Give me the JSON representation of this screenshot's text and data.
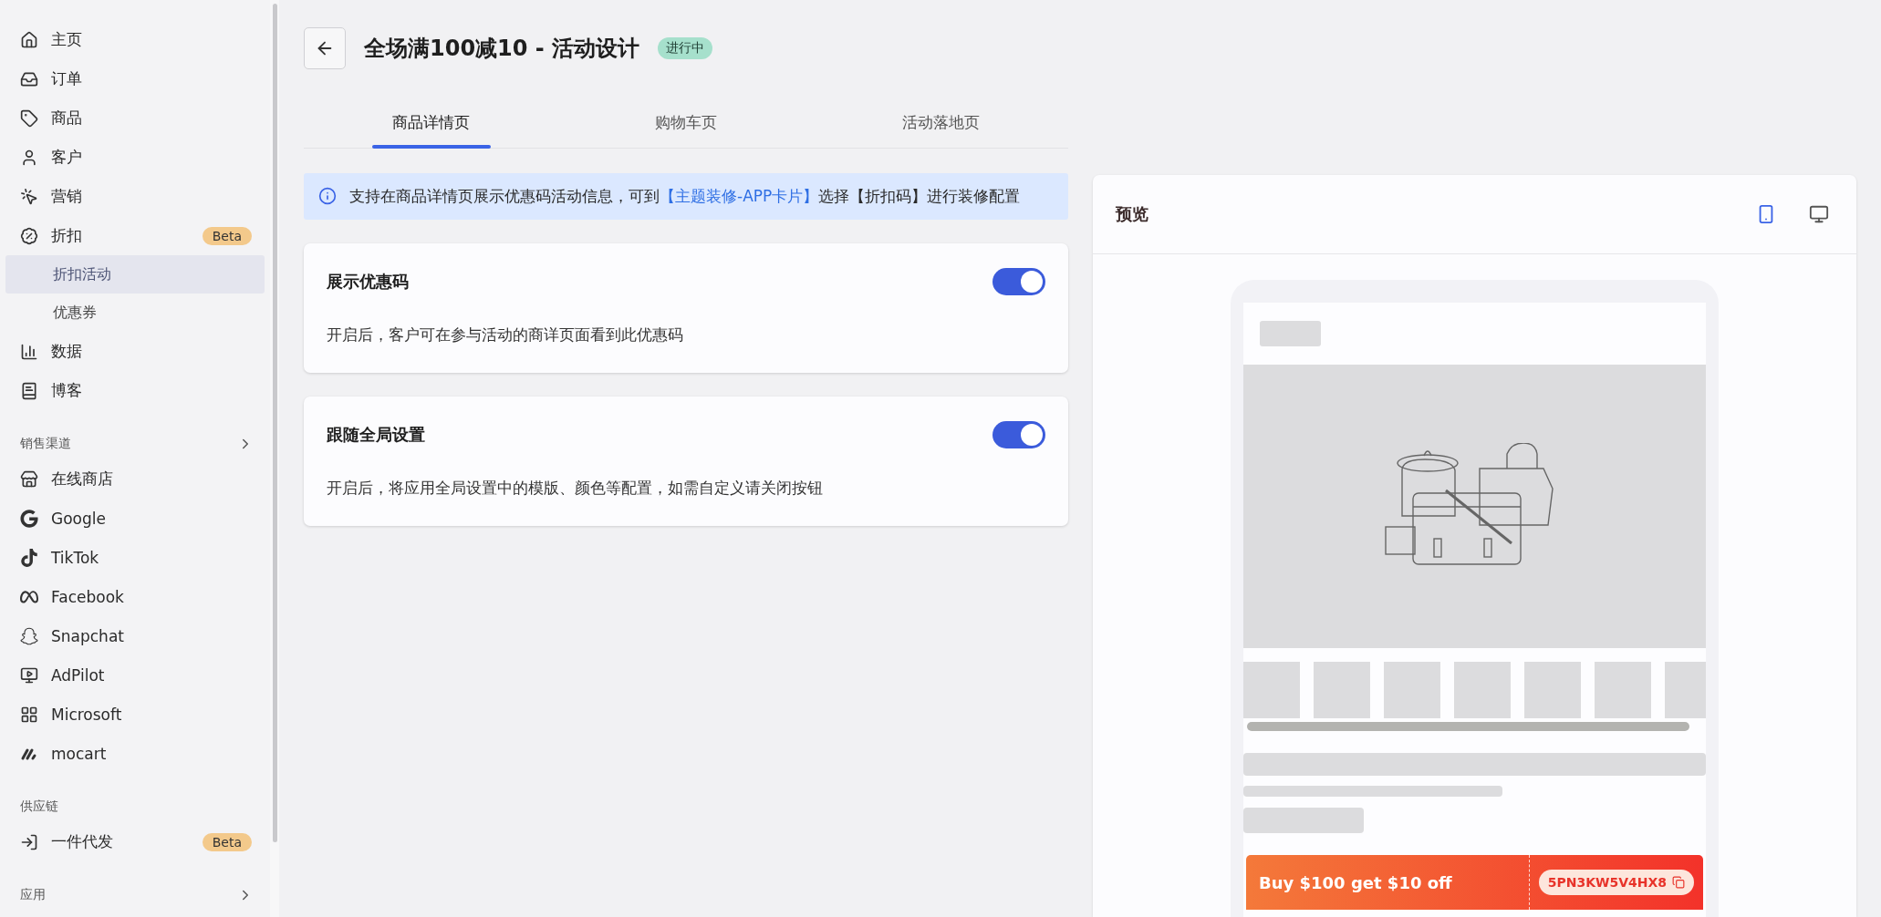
{
  "sidebar": {
    "sections": [
      {
        "items": [
          {
            "label": "主页",
            "selected": false
          },
          {
            "label": "订单",
            "selected": false
          },
          {
            "label": "商品",
            "selected": false
          },
          {
            "label": "客户",
            "selected": false
          },
          {
            "label": "营销",
            "selected": false
          },
          {
            "label": "折扣",
            "selected": false,
            "badge": "Beta",
            "children": [
              {
                "label": "折扣活动",
                "selected": true
              },
              {
                "label": "优惠券",
                "selected": false
              }
            ]
          },
          {
            "label": "数据",
            "selected": false
          },
          {
            "label": "博客",
            "selected": false
          }
        ]
      },
      {
        "title": "销售渠道",
        "collapsible": true,
        "items": [
          {
            "label": "在线商店",
            "selected": false
          },
          {
            "label": "Google",
            "selected": false
          },
          {
            "label": "TikTok",
            "selected": false
          },
          {
            "label": "Facebook",
            "selected": false
          },
          {
            "label": "Snapchat",
            "selected": false
          },
          {
            "label": "AdPilot",
            "selected": false
          },
          {
            "label": "Microsoft",
            "selected": false
          },
          {
            "label": "mocart",
            "selected": false
          }
        ]
      },
      {
        "title": "供应链",
        "collapsible": false,
        "items": [
          {
            "label": "一件代发",
            "selected": false,
            "badge": "Beta"
          }
        ]
      },
      {
        "title": "应用",
        "collapsible": true
      }
    ]
  },
  "header": {
    "title": "全场满100减10 - 活动设计",
    "status": "进行中"
  },
  "tabs": [
    {
      "label": "商品详情页",
      "selected": true
    },
    {
      "label": "购物车页",
      "selected": false
    },
    {
      "label": "活动落地页",
      "selected": false
    }
  ],
  "info": {
    "text_before": "支持在商品详情页展示优惠码活动信息，可到",
    "link": "【主题装修-APP卡片】",
    "text_after": "选择【折扣码】进行装修配置"
  },
  "cards": [
    {
      "title": "展示优惠码",
      "description": "开启后，客户可在参与活动的商详页面看到此优惠码",
      "on": true
    },
    {
      "title": "跟随全局设置",
      "description": "开启后，将应用全局设置中的模版、颜色等配置，如需自定义请关闭按钮",
      "on": true
    }
  ],
  "preview": {
    "title": "预览",
    "devices": [
      {
        "selected": true
      },
      {
        "selected": false
      }
    ],
    "coupon": {
      "text": "Buy $100 get $10 off",
      "code": "5PN3KW5V4HX8"
    }
  }
}
